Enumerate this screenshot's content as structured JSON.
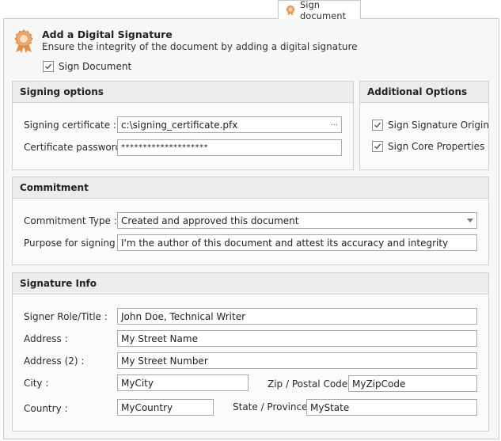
{
  "tab": {
    "label": "Sign document"
  },
  "header": {
    "title": "Add a Digital Signature",
    "subtitle": "Ensure the integrity of the document by adding a digital signature",
    "sign_document_label": "Sign Document"
  },
  "signing_options": {
    "title": "Signing options",
    "certificate_label": "Signing certificate :",
    "certificate_value": "c:\\signing_certificate.pfx",
    "browse_label": "...",
    "password_label": "Certificate password :",
    "password_value": "********************"
  },
  "additional_options": {
    "title": "Additional Options",
    "sign_signature_origin": "Sign Signature Origin",
    "sign_core_properties": "Sign Core Properties"
  },
  "commitment": {
    "title": "Commitment",
    "type_label": "Commitment Type :",
    "type_value": "Created and approved this document",
    "purpose_label": "Purpose for signing :",
    "purpose_value": "I'm the author of this document and attest its accuracy and integrity"
  },
  "signature_info": {
    "title": "Signature Info",
    "role_label": "Signer Role/Title :",
    "role_value": "John Doe, Technical Writer",
    "address_label": "Address :",
    "address_value": "My Street Name",
    "address2_label": "Address (2) :",
    "address2_value": "My Street Number",
    "city_label": "City :",
    "city_value": "MyCity",
    "zip_label": "Zip / Postal Code :",
    "zip_value": "MyZipCode",
    "country_label": "Country :",
    "country_value": "MyCountry",
    "state_label": "State / Province :",
    "state_value": "MyState"
  }
}
